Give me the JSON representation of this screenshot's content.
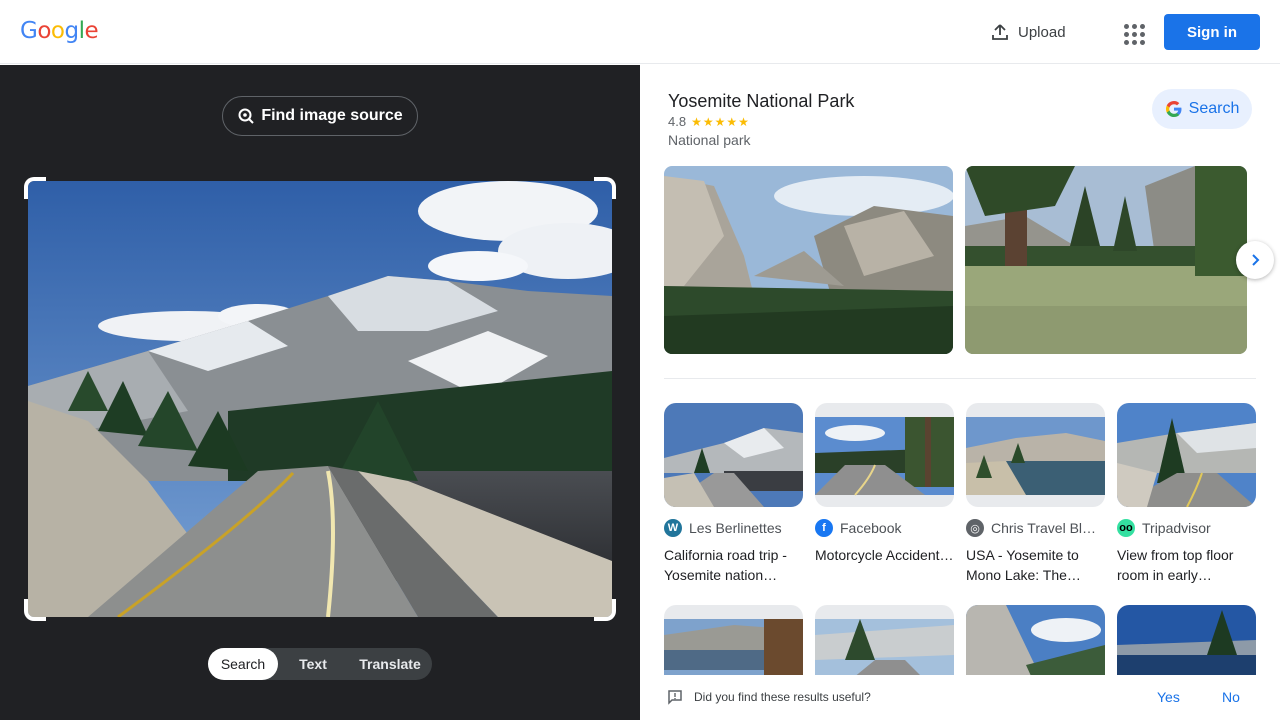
{
  "header": {
    "logo_text": "Google",
    "upload_label": "Upload",
    "signin_label": "Sign in"
  },
  "lens": {
    "find_source_label": "Find image source",
    "modes": [
      "Search",
      "Text",
      "Translate"
    ],
    "active_mode": "Search"
  },
  "knowledge_panel": {
    "title": "Yosemite National Park",
    "rating": "4.8",
    "stars": 5,
    "subtitle": "National park",
    "search_label": "Search"
  },
  "results": [
    {
      "source": "Les Berlinettes",
      "icon": "wordpress-icon",
      "title": "California road trip - Yosemite nation…"
    },
    {
      "source": "Facebook",
      "icon": "facebook-icon",
      "title": "Motorcycle Accident…"
    },
    {
      "source": "Chris Travel Bl…",
      "icon": "globe-icon",
      "title": "USA - Yosemite to Mono Lake: The…"
    },
    {
      "source": "Tripadvisor",
      "icon": "tripadvisor-icon",
      "title": "View from top floor room in early…"
    }
  ],
  "feedback": {
    "question": "Did you find these results useful?",
    "yes_label": "Yes",
    "no_label": "No"
  },
  "colors": {
    "accent": "#1a73e8",
    "dark_panel": "#202124",
    "star": "#fbbc04"
  }
}
